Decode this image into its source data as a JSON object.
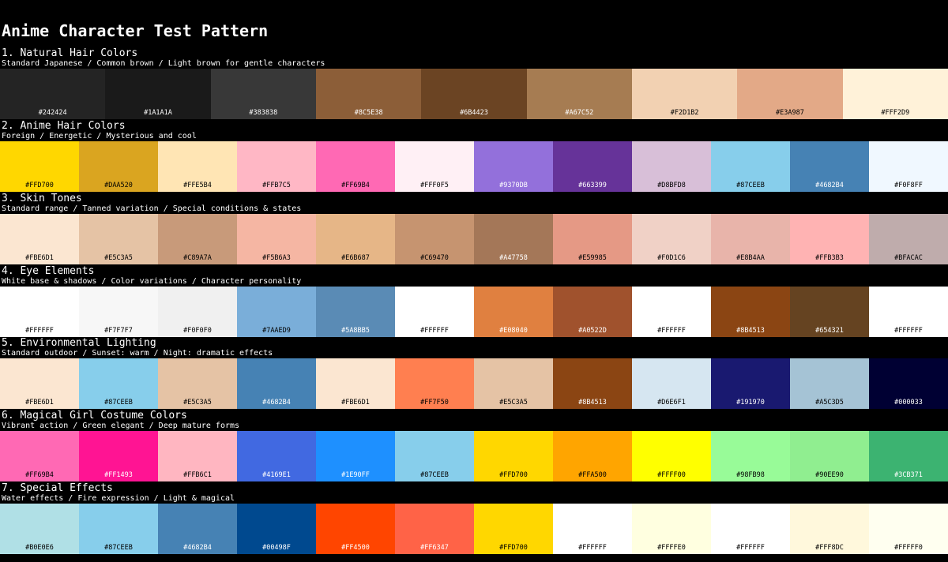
{
  "title": "Anime Character Test Pattern",
  "sections": [
    {
      "title": "1. Natural Hair Colors",
      "subtitle": "Standard Japanese / Common brown / Light brown for gentle characters",
      "colors": [
        "#242424",
        "#1A1A1A",
        "#383838",
        "#8C5E38",
        "#6B4423",
        "#A67C52",
        "#F2D1B2",
        "#E3A987",
        "#FFF2D9"
      ]
    },
    {
      "title": "2. Anime Hair Colors",
      "subtitle": "Foreign / Energetic / Mysterious and cool",
      "colors": [
        "#FFD700",
        "#DAA520",
        "#FFE5B4",
        "#FFB7C5",
        "#FF69B4",
        "#FFF0F5",
        "#9370DB",
        "#663399",
        "#D8BFD8",
        "#87CEEB",
        "#4682B4",
        "#F0F8FF"
      ]
    },
    {
      "title": "3. Skin Tones",
      "subtitle": "Standard range / Tanned variation / Special conditions & states",
      "colors": [
        "#FBE6D1",
        "#E5C3A5",
        "#C89A7A",
        "#F5B6A3",
        "#E6B687",
        "#C69470",
        "#A47758",
        "#E59985",
        "#F0D1C6",
        "#E8B4AA",
        "#FFB3B3",
        "#BFACAC"
      ]
    },
    {
      "title": "4. Eye Elements",
      "subtitle": "White base & shadows / Color variations / Character personality",
      "colors": [
        "#FFFFFF",
        "#F7F7F7",
        "#F0F0F0",
        "#7AAED9",
        "#5A8BB5",
        "#FFFFFF",
        "#E08040",
        "#A0522D",
        "#FFFFFF",
        "#8B4513",
        "#654321",
        "#FFFFFF"
      ]
    },
    {
      "title": "5. Environmental Lighting",
      "subtitle": "Standard outdoor / Sunset: warm / Night: dramatic effects",
      "colors": [
        "#FBE6D1",
        "#87CEEB",
        "#E5C3A5",
        "#4682B4",
        "#FBE6D1",
        "#FF7F50",
        "#E5C3A5",
        "#8B4513",
        "#D6E6F1",
        "#191970",
        "#A5C3D5",
        "#000033"
      ]
    },
    {
      "title": "6. Magical Girl Costume Colors",
      "subtitle": "Vibrant action / Green elegant / Deep mature forms",
      "colors": [
        "#FF69B4",
        "#FF1493",
        "#FFB6C1",
        "#4169E1",
        "#1E90FF",
        "#87CEEB",
        "#FFD700",
        "#FFA500",
        "#FFFF00",
        "#98FB98",
        "#90EE90",
        "#3CB371"
      ]
    },
    {
      "title": "7. Special Effects",
      "subtitle": "Water effects / Fire expression / Light & magical",
      "colors": [
        "#B0E0E6",
        "#87CEEB",
        "#4682B4",
        "#00498F",
        "#FF4500",
        "#FF6347",
        "#FFD700",
        "#FFFFFF",
        "#FFFFE0",
        "#FFFFFF",
        "#FFF8DC",
        "#FFFFF0"
      ]
    }
  ]
}
